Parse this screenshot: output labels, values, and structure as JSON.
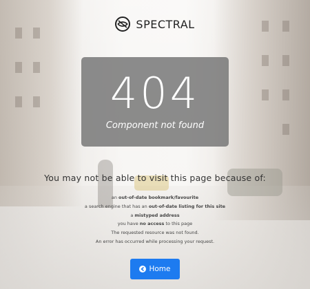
{
  "brand": {
    "name": "SPECTRAL",
    "logo_icon": "spectral-logo-icon"
  },
  "error": {
    "code": "404",
    "message": "Component not found"
  },
  "reasons": {
    "title": "You may not be able to visit this page because of:",
    "items": [
      {
        "before": "an ",
        "bold": "out-of-date bookmark/favourite",
        "after": ""
      },
      {
        "before": "a search engine that has an ",
        "bold": "out-of-date listing for this site",
        "after": ""
      },
      {
        "before": "a ",
        "bold": "mistyped address",
        "after": ""
      },
      {
        "before": "you have ",
        "bold": "no access",
        "after": " to this page"
      },
      {
        "before": "The requested resource was not found.",
        "bold": "",
        "after": ""
      },
      {
        "before": "An error has occurred while processing your request.",
        "bold": "",
        "after": ""
      }
    ]
  },
  "home_button": {
    "label": "Home",
    "icon": "arrow-circle-left-icon",
    "color": "#1d7bf0"
  }
}
